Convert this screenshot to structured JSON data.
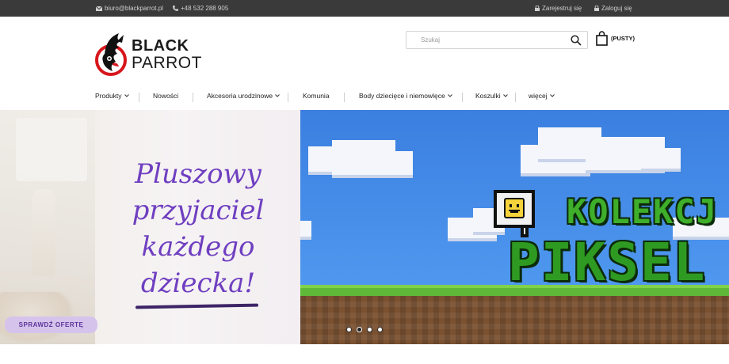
{
  "topbar": {
    "email": "biuro@blackparrot.pl",
    "phone": "+48 532 288 905",
    "register": "Zarejestruj się",
    "login": "Zaloguj się"
  },
  "logo": {
    "line1": "BLACK",
    "line2": "PARROT"
  },
  "search": {
    "placeholder": "Szukaj"
  },
  "cart": {
    "label": "(PUSTY)"
  },
  "nav": {
    "items": [
      {
        "label": "Produkty",
        "dropdown": true
      },
      {
        "label": "Nowości",
        "dropdown": false
      },
      {
        "label": "Akcesoria urodzinowe",
        "dropdown": true
      },
      {
        "label": "Komunia",
        "dropdown": false
      },
      {
        "label": "Body dziecięce i niemowlęce",
        "dropdown": true
      },
      {
        "label": "Koszulki",
        "dropdown": true
      },
      {
        "label": "więcej",
        "dropdown": true
      }
    ]
  },
  "banner_left": {
    "line1": "Pluszowy",
    "line2": "przyjaciel",
    "line3": "każdego",
    "line4": "dziecka!",
    "cta": "SPRAWDŹ OFERTĘ"
  },
  "banner_right": {
    "title_top": "KOLEKCJ",
    "title_bottom": "PIKSEL"
  },
  "slider": {
    "slides": 4,
    "active": 2
  },
  "colors": {
    "topbar": "#3a3a3a",
    "accent_purple": "#6f3fc0",
    "logo_red": "#d7161c"
  }
}
